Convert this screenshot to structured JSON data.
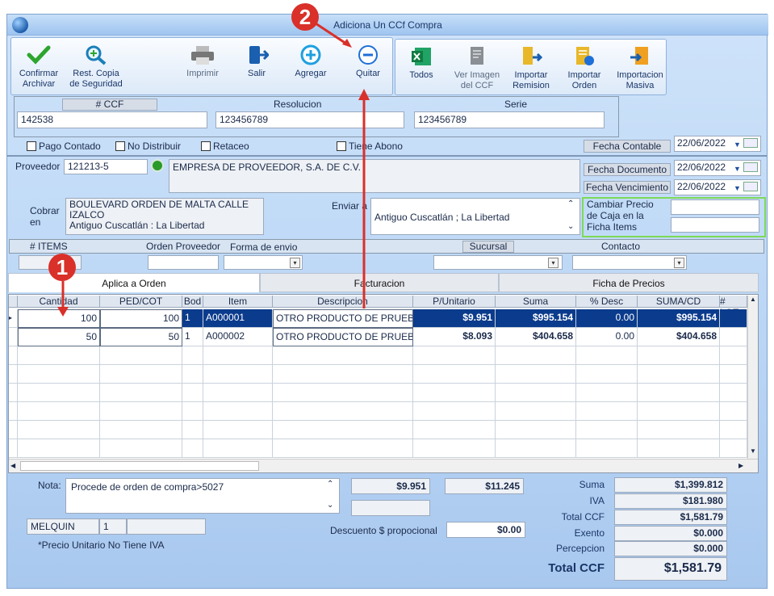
{
  "window": {
    "title": "Adiciona Un CCf Compra"
  },
  "toolbar": {
    "confirmar": "Confirmar\nArchivar",
    "rest_copia": "Rest. Copia\nde Seguridad",
    "imprimir": "Imprimir",
    "salir": "Salir",
    "agregar": "Agregar",
    "quitar": "Quitar",
    "todos": "Todos",
    "ver_imagen": "Ver Imagen\ndel CCF",
    "importar_remision": "Importar\nRemision",
    "importar_orden": "Importar\nOrden",
    "importacion_masiva": "Importacion\nMasiva"
  },
  "header": {
    "ccf_label": "# CCF",
    "ccf_value": "142538",
    "resolucion_label": "Resolucion",
    "resolucion_value": "123456789",
    "serie_label": "Serie",
    "serie_value": "123456789"
  },
  "checks": {
    "pago_contado": "Pago Contado",
    "no_distribuir": "No Distribuir",
    "retaceo": "Retaceo",
    "tiene_abono": "Tiene Abono"
  },
  "fechas": {
    "contable_label": "Fecha Contable",
    "contable_value": "22/06/2022",
    "documento_label": "Fecha Documento",
    "documento_value": "22/06/2022",
    "vencimiento_label": "Fecha Vencimiento",
    "vencimiento_value": "22/06/2022"
  },
  "proveedor": {
    "label": "Proveedor",
    "code": "121213-5",
    "name": "EMPRESA DE PROVEEDOR, S.A. DE C.V."
  },
  "cobrar": {
    "label": "Cobrar\nen",
    "value": "BOULEVARD ORDEN DE MALTA CALLE\nIZALCO\nAntiguo Cuscatlán : La Libertad"
  },
  "enviar": {
    "label": "Enviar a",
    "value": "Antiguo Cuscatlán ; La Libertad"
  },
  "cambiar_precio": "Cambiar Precio\nde Caja en la\nFicha Items",
  "filters": {
    "items": "# ITEMS",
    "orden_proveedor": "Orden Proveedor",
    "forma_envio": "Forma de envio",
    "sucursal": "Sucursal",
    "contacto": "Contacto"
  },
  "tabs": [
    "Aplica a Orden",
    "Facturacion",
    "Ficha de Precios"
  ],
  "grid": {
    "columns": [
      "Cantidad",
      "PED/COT",
      "Bod",
      "Item",
      "Descripcion",
      "P/Unitario",
      "Suma",
      "% Desc",
      "SUMA/CD",
      "# LOT"
    ],
    "rows": [
      [
        "100",
        "100",
        "1",
        "A000001",
        "OTRO PRODUCTO DE PRUEB",
        "$9.951",
        "$995.154",
        "0.00",
        "$995.154"
      ],
      [
        "50",
        "50",
        "1",
        "A000002",
        "OTRO PRODUCTO DE PRUEB",
        "$8.093",
        "$404.658",
        "0.00",
        "$404.658"
      ]
    ]
  },
  "footer": {
    "nota_label": "Nota:",
    "nota_value": "Procede de orden de compra>5027",
    "box1": "$9.951",
    "box2": "$11.245",
    "user": "MELQUIN",
    "user_num": "1",
    "descuento_label": "Descuento $ propocional",
    "descuento_value": "$0.00",
    "nota_iva": "*Precio Unitario No Tiene IVA"
  },
  "totals": {
    "suma_label": "Suma",
    "suma": "$1,399.812",
    "iva_label": "IVA",
    "iva": "$181.980",
    "total_ccf_label": "Total CCF",
    "total_ccf": "$1,581.79",
    "exento_label": "Exento",
    "exento": "$0.000",
    "percepcion_label": "Percepcion",
    "percepcion": "$0.000",
    "grand_label": "Total CCF",
    "grand": "$1,581.79"
  },
  "annotations": {
    "one": "1",
    "two": "2"
  },
  "colors": {
    "selected_row": "#0b3b8c",
    "annotation": "#d9302a",
    "highlight_border": "#7ed957"
  }
}
